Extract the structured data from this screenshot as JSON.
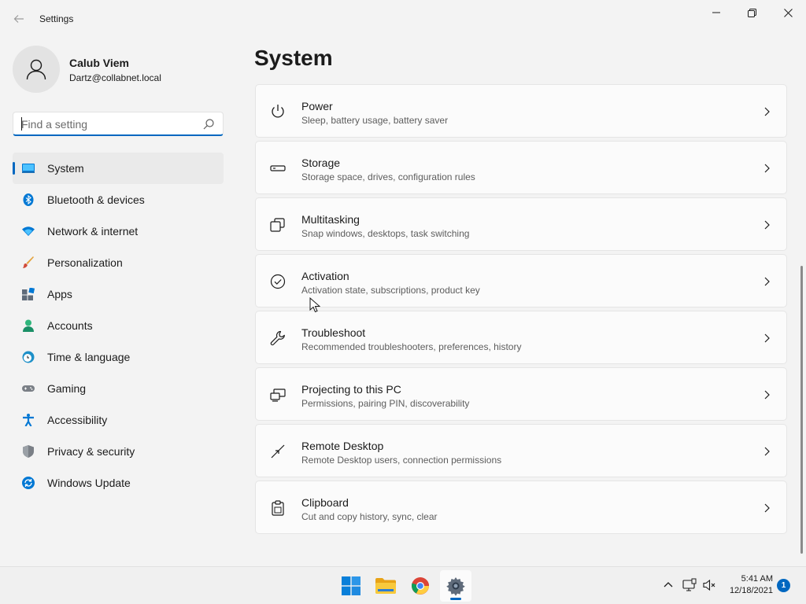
{
  "app": {
    "title": "Settings"
  },
  "user": {
    "name": "Calub Viem",
    "email": "Dartz@collabnet.local"
  },
  "search": {
    "placeholder": "Find a setting",
    "value": ""
  },
  "sidebar": {
    "items": [
      {
        "label": "System",
        "icon": "system-icon",
        "active": true
      },
      {
        "label": "Bluetooth & devices",
        "icon": "bluetooth-icon"
      },
      {
        "label": "Network & internet",
        "icon": "wifi-icon"
      },
      {
        "label": "Personalization",
        "icon": "brush-icon"
      },
      {
        "label": "Apps",
        "icon": "apps-icon"
      },
      {
        "label": "Accounts",
        "icon": "person-icon"
      },
      {
        "label": "Time & language",
        "icon": "globe-clock-icon"
      },
      {
        "label": "Gaming",
        "icon": "gamepad-icon"
      },
      {
        "label": "Accessibility",
        "icon": "accessibility-icon"
      },
      {
        "label": "Privacy & security",
        "icon": "shield-icon"
      },
      {
        "label": "Windows Update",
        "icon": "update-icon"
      }
    ]
  },
  "main": {
    "title": "System",
    "cards": [
      {
        "title": "Power",
        "subtitle": "Sleep, battery usage, battery saver",
        "icon": "power-icon"
      },
      {
        "title": "Storage",
        "subtitle": "Storage space, drives, configuration rules",
        "icon": "storage-icon"
      },
      {
        "title": "Multitasking",
        "subtitle": "Snap windows, desktops, task switching",
        "icon": "multitasking-icon"
      },
      {
        "title": "Activation",
        "subtitle": "Activation state, subscriptions, product key",
        "icon": "activation-check-icon"
      },
      {
        "title": "Troubleshoot",
        "subtitle": "Recommended troubleshooters, preferences, history",
        "icon": "wrench-icon"
      },
      {
        "title": "Projecting to this PC",
        "subtitle": "Permissions, pairing PIN, discoverability",
        "icon": "projecting-icon"
      },
      {
        "title": "Remote Desktop",
        "subtitle": "Remote Desktop users, connection permissions",
        "icon": "remote-desktop-icon"
      },
      {
        "title": "Clipboard",
        "subtitle": "Cut and copy history, sync, clear",
        "icon": "clipboard-icon"
      }
    ]
  },
  "taskbar": {
    "apps": [
      "start-icon",
      "file-explorer-icon",
      "chrome-icon",
      "settings-gear-icon"
    ],
    "time": "5:41 AM",
    "date": "12/18/2021",
    "notification_count": "1"
  },
  "colors": {
    "accent": "#0067c0",
    "background": "#f3f3f3",
    "card": "#fbfbfb"
  }
}
